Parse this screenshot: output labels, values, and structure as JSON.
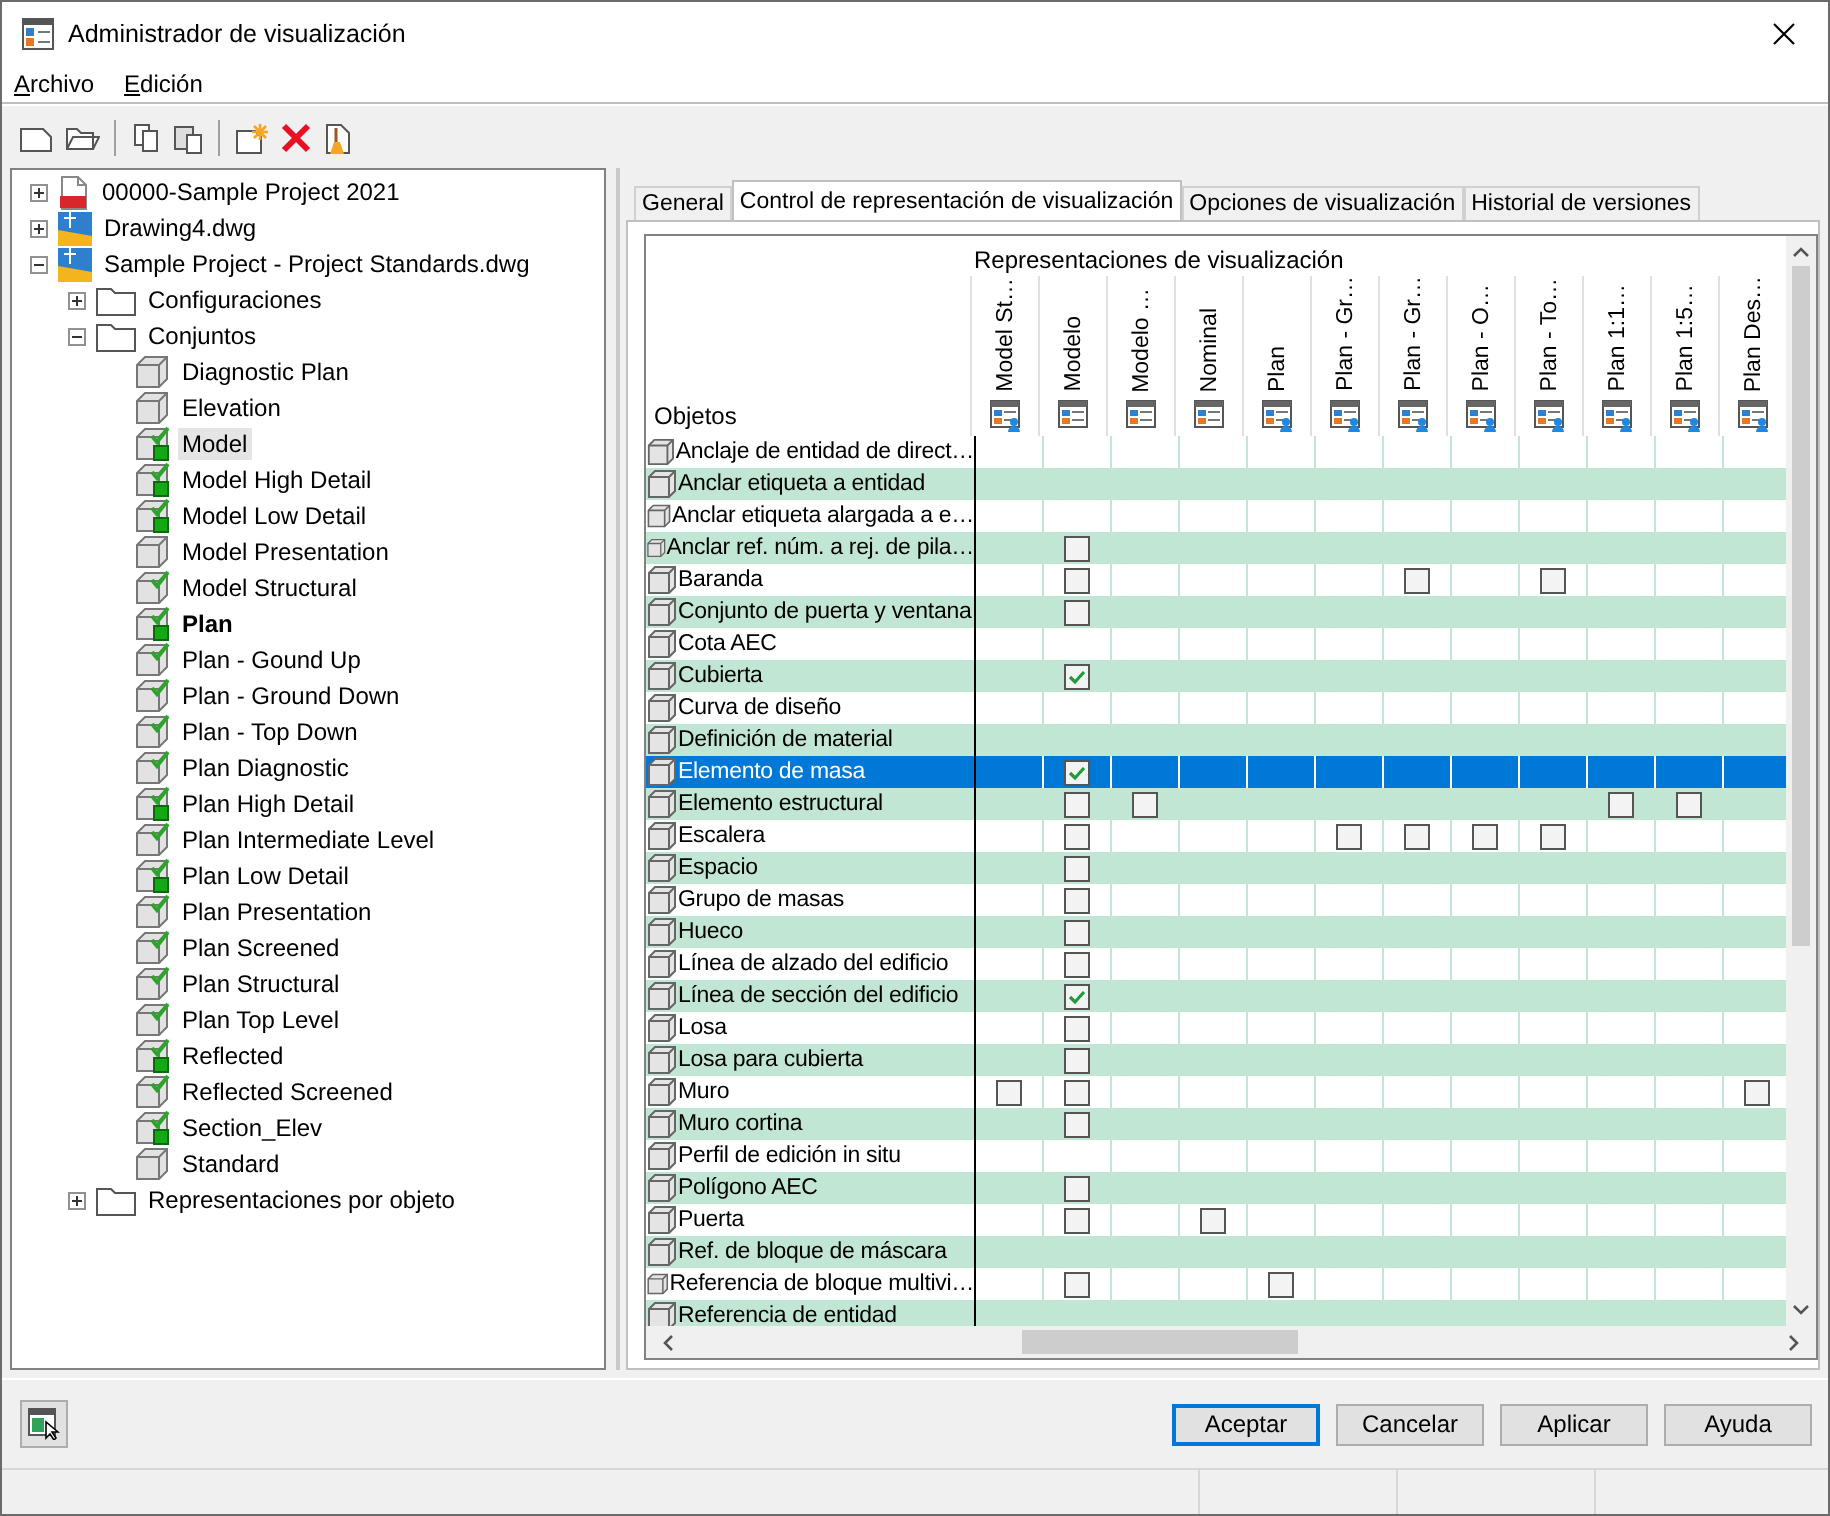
{
  "window": {
    "title": "Administrador de visualización"
  },
  "menu": [
    "Archivo",
    "Edición"
  ],
  "tree": [
    {
      "label": "00000-Sample Project 2021",
      "kind": "project",
      "expanded": false,
      "selected": false
    },
    {
      "label": "Drawing4.dwg",
      "kind": "drawing",
      "expanded": false,
      "selected": false
    },
    {
      "label": "Sample Project - Project Standards.dwg",
      "kind": "drawing",
      "expanded": true,
      "selected": false,
      "children": [
        {
          "label": "Configuraciones",
          "kind": "folder",
          "expanded": false,
          "selected": false
        },
        {
          "label": "Conjuntos",
          "kind": "folder",
          "expanded": true,
          "selected": false,
          "children": [
            {
              "label": "Diagnostic Plan",
              "kind": "set",
              "selected": false,
              "current": false
            },
            {
              "label": "Elevation",
              "kind": "set",
              "selected": false,
              "current": false
            },
            {
              "label": "Model",
              "kind": "set-default",
              "selected": true,
              "current": false
            },
            {
              "label": "Model High Detail",
              "kind": "set-default",
              "selected": false,
              "current": false
            },
            {
              "label": "Model Low Detail",
              "kind": "set-default",
              "selected": false,
              "current": false
            },
            {
              "label": "Model Presentation",
              "kind": "set",
              "selected": false,
              "current": false
            },
            {
              "label": "Model Structural",
              "kind": "set-checked",
              "selected": false,
              "current": false
            },
            {
              "label": "Plan",
              "kind": "set-default",
              "selected": false,
              "current": true
            },
            {
              "label": "Plan - Gound Up",
              "kind": "set-checked",
              "selected": false,
              "current": false
            },
            {
              "label": "Plan - Ground Down",
              "kind": "set-checked",
              "selected": false,
              "current": false
            },
            {
              "label": "Plan - Top Down",
              "kind": "set-checked",
              "selected": false,
              "current": false
            },
            {
              "label": "Plan Diagnostic",
              "kind": "set-checked",
              "selected": false,
              "current": false
            },
            {
              "label": "Plan High Detail",
              "kind": "set-default",
              "selected": false,
              "current": false
            },
            {
              "label": "Plan Intermediate Level",
              "kind": "set-checked",
              "selected": false,
              "current": false
            },
            {
              "label": "Plan Low Detail",
              "kind": "set-default",
              "selected": false,
              "current": false
            },
            {
              "label": "Plan Presentation",
              "kind": "set-checked",
              "selected": false,
              "current": false
            },
            {
              "label": "Plan Screened",
              "kind": "set-checked",
              "selected": false,
              "current": false
            },
            {
              "label": "Plan Structural",
              "kind": "set-checked",
              "selected": false,
              "current": false
            },
            {
              "label": "Plan Top Level",
              "kind": "set-checked",
              "selected": false,
              "current": false
            },
            {
              "label": "Reflected",
              "kind": "set-default",
              "selected": false,
              "current": false
            },
            {
              "label": "Reflected Screened",
              "kind": "set-checked",
              "selected": false,
              "current": false
            },
            {
              "label": "Section_Elev",
              "kind": "set-default",
              "selected": false,
              "current": false
            },
            {
              "label": "Standard",
              "kind": "set",
              "selected": false,
              "current": false
            }
          ]
        },
        {
          "label": "Representaciones por objeto",
          "kind": "folder",
          "expanded": false,
          "selected": false
        }
      ]
    }
  ],
  "tabs": [
    {
      "label": "General",
      "selected": false
    },
    {
      "label": "Control de representación de visualización",
      "selected": true
    },
    {
      "label": "Opciones de visualización",
      "selected": false
    },
    {
      "label": "Historial de versiones",
      "selected": false
    }
  ],
  "grid": {
    "group_heading": "Representaciones de visualización",
    "objects_heading": "Objetos",
    "columns": [
      {
        "label": "Model St…",
        "kind": "user"
      },
      {
        "label": "Modelo",
        "kind": "plain"
      },
      {
        "label": "Modelo …",
        "kind": "plain"
      },
      {
        "label": "Nominal",
        "kind": "plain"
      },
      {
        "label": "Plan",
        "kind": "user"
      },
      {
        "label": "Plan - Gr…",
        "kind": "user"
      },
      {
        "label": "Plan - Gr…",
        "kind": "user"
      },
      {
        "label": "Plan - O…",
        "kind": "user"
      },
      {
        "label": "Plan - To…",
        "kind": "user"
      },
      {
        "label": "Plan 1:1…",
        "kind": "user"
      },
      {
        "label": "Plan 1:5…",
        "kind": "user"
      },
      {
        "label": "Plan Des…",
        "kind": "user"
      }
    ],
    "rows": [
      {
        "label": "Anclaje de entidad de direct…",
        "selected": false,
        "cells": [
          null,
          null,
          null,
          null,
          null,
          null,
          null,
          null,
          null,
          null,
          null,
          null
        ]
      },
      {
        "label": "Anclar etiqueta a entidad",
        "selected": false,
        "cells": [
          null,
          null,
          null,
          null,
          null,
          null,
          null,
          null,
          null,
          null,
          null,
          null
        ]
      },
      {
        "label": "Anclar etiqueta alargada a e…",
        "selected": false,
        "cells": [
          null,
          null,
          null,
          null,
          null,
          null,
          null,
          null,
          null,
          null,
          null,
          null
        ]
      },
      {
        "label": "Anclar ref. núm. a rej. de pila…",
        "selected": false,
        "cells": [
          null,
          false,
          null,
          null,
          null,
          null,
          null,
          null,
          null,
          null,
          null,
          null
        ]
      },
      {
        "label": "Baranda",
        "selected": false,
        "cells": [
          null,
          false,
          null,
          null,
          null,
          null,
          false,
          null,
          false,
          null,
          null,
          null
        ]
      },
      {
        "label": "Conjunto de puerta y ventana",
        "selected": false,
        "cells": [
          null,
          false,
          null,
          null,
          null,
          null,
          null,
          null,
          null,
          null,
          null,
          null
        ]
      },
      {
        "label": "Cota AEC",
        "selected": false,
        "cells": [
          null,
          null,
          null,
          null,
          null,
          null,
          null,
          null,
          null,
          null,
          null,
          null
        ]
      },
      {
        "label": "Cubierta",
        "selected": false,
        "cells": [
          null,
          true,
          null,
          null,
          null,
          null,
          null,
          null,
          null,
          null,
          null,
          null
        ]
      },
      {
        "label": "Curva de diseño",
        "selected": false,
        "cells": [
          null,
          null,
          null,
          null,
          null,
          null,
          null,
          null,
          null,
          null,
          null,
          null
        ]
      },
      {
        "label": "Definición de material",
        "selected": false,
        "cells": [
          null,
          null,
          null,
          null,
          null,
          null,
          null,
          null,
          null,
          null,
          null,
          null
        ]
      },
      {
        "label": "Elemento de masa",
        "selected": true,
        "cells": [
          null,
          true,
          null,
          null,
          null,
          null,
          null,
          null,
          null,
          null,
          null,
          null
        ]
      },
      {
        "label": "Elemento estructural",
        "selected": false,
        "cells": [
          null,
          false,
          false,
          null,
          null,
          null,
          null,
          null,
          null,
          false,
          false,
          null
        ]
      },
      {
        "label": "Escalera",
        "selected": false,
        "cells": [
          null,
          false,
          null,
          null,
          null,
          false,
          false,
          false,
          false,
          null,
          null,
          null
        ]
      },
      {
        "label": "Espacio",
        "selected": false,
        "cells": [
          null,
          false,
          null,
          null,
          null,
          null,
          null,
          null,
          null,
          null,
          null,
          null
        ]
      },
      {
        "label": "Grupo de masas",
        "selected": false,
        "cells": [
          null,
          false,
          null,
          null,
          null,
          null,
          null,
          null,
          null,
          null,
          null,
          null
        ]
      },
      {
        "label": "Hueco",
        "selected": false,
        "cells": [
          null,
          false,
          null,
          null,
          null,
          null,
          null,
          null,
          null,
          null,
          null,
          null
        ]
      },
      {
        "label": "Línea de alzado del edificio",
        "selected": false,
        "cells": [
          null,
          false,
          null,
          null,
          null,
          null,
          null,
          null,
          null,
          null,
          null,
          null
        ]
      },
      {
        "label": "Línea de sección del edificio",
        "selected": false,
        "cells": [
          null,
          true,
          null,
          null,
          null,
          null,
          null,
          null,
          null,
          null,
          null,
          null
        ]
      },
      {
        "label": "Losa",
        "selected": false,
        "cells": [
          null,
          false,
          null,
          null,
          null,
          null,
          null,
          null,
          null,
          null,
          null,
          null
        ]
      },
      {
        "label": "Losa para cubierta",
        "selected": false,
        "cells": [
          null,
          false,
          null,
          null,
          null,
          null,
          null,
          null,
          null,
          null,
          null,
          null
        ]
      },
      {
        "label": "Muro",
        "selected": false,
        "cells": [
          false,
          false,
          null,
          null,
          null,
          null,
          null,
          null,
          null,
          null,
          null,
          false
        ]
      },
      {
        "label": "Muro cortina",
        "selected": false,
        "cells": [
          null,
          false,
          null,
          null,
          null,
          null,
          null,
          null,
          null,
          null,
          null,
          null
        ]
      },
      {
        "label": "Perfil de edición in situ",
        "selected": false,
        "cells": [
          null,
          null,
          null,
          null,
          null,
          null,
          null,
          null,
          null,
          null,
          null,
          null
        ]
      },
      {
        "label": "Polígono AEC",
        "selected": false,
        "cells": [
          null,
          false,
          null,
          null,
          null,
          null,
          null,
          null,
          null,
          null,
          null,
          null
        ]
      },
      {
        "label": "Puerta",
        "selected": false,
        "cells": [
          null,
          false,
          null,
          false,
          null,
          null,
          null,
          null,
          null,
          null,
          null,
          null
        ]
      },
      {
        "label": "Ref. de bloque de máscara",
        "selected": false,
        "cells": [
          null,
          null,
          null,
          null,
          null,
          null,
          null,
          null,
          null,
          null,
          null,
          null
        ]
      },
      {
        "label": "Referencia de bloque multivi…",
        "selected": false,
        "cells": [
          null,
          false,
          null,
          null,
          false,
          null,
          null,
          null,
          null,
          null,
          null,
          null
        ]
      },
      {
        "label": "Referencia de entidad",
        "selected": false,
        "cells": [
          null,
          null,
          null,
          null,
          null,
          null,
          null,
          null,
          null,
          null,
          null,
          null
        ]
      }
    ]
  },
  "buttons": [
    {
      "label": "Aceptar",
      "kind": "default"
    },
    {
      "label": "Cancelar",
      "kind": "normal"
    },
    {
      "label": "Aplicar",
      "kind": "normal"
    },
    {
      "label": "Ayuda",
      "kind": "normal"
    }
  ]
}
